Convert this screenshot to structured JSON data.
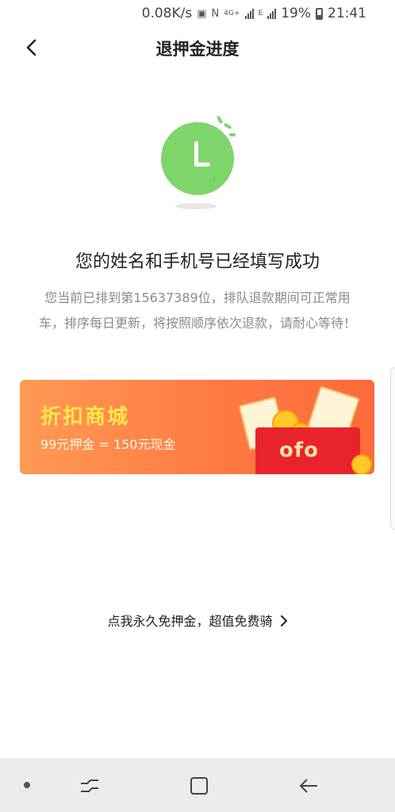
{
  "status_bar": {
    "net_speed": "0.08K/s",
    "net_type": "4G+",
    "net_type_2": "E",
    "battery": "19%",
    "time": "21:41"
  },
  "header": {
    "title": "退押金进度",
    "back_icon": "chevron-left-icon"
  },
  "status": {
    "icon": "clock-icon",
    "title": "您的姓名和手机号已经填写成功",
    "description_line1": "您当前已排到第15637389位，排队退款期间可正常用",
    "description_line2": "车，排序每日更新，将按照顺序依次退款，请耐心等待！"
  },
  "promo": {
    "title": "折扣商城",
    "subtitle": "99元押金 = 150元现金",
    "logo_text": "ofo",
    "colors": {
      "title": "#ffe94a",
      "background": "#ff7a45",
      "envelope": "#e9232c"
    }
  },
  "free_deposit_link": {
    "label": "点我永久免押金，超值免费骑",
    "icon": "chevron-right-icon"
  },
  "system_nav": {
    "icons": [
      "dot-icon",
      "recent-apps-icon",
      "home-icon",
      "back-arrow-icon"
    ]
  },
  "colors": {
    "accent_green": "#7ed66a",
    "text_primary": "#222222",
    "text_secondary": "#8a8a8a"
  }
}
